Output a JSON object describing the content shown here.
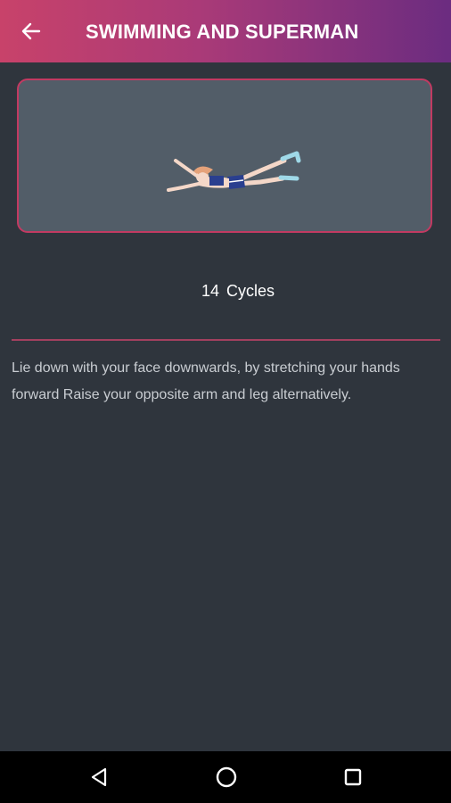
{
  "app_bar": {
    "title": "SWIMMING AND SUPERMAN",
    "back_icon": "arrow-left-icon",
    "gradient": [
      "#c8426a",
      "#6b2c80"
    ]
  },
  "exercise": {
    "illustration": "woman-superman-pose-illustration",
    "cycles_count": "14",
    "cycles_unit": "Cycles",
    "description": "Lie down with your face downwards, by stretching your hands forward Raise your opposite arm and leg alternatively."
  },
  "colors": {
    "background": "#2f353d",
    "card_background": "#525d68",
    "accent": "#c23a62"
  },
  "nav_bar": {
    "back_icon": "triangle-back-icon",
    "home_icon": "circle-home-icon",
    "recent_icon": "square-recents-icon"
  }
}
